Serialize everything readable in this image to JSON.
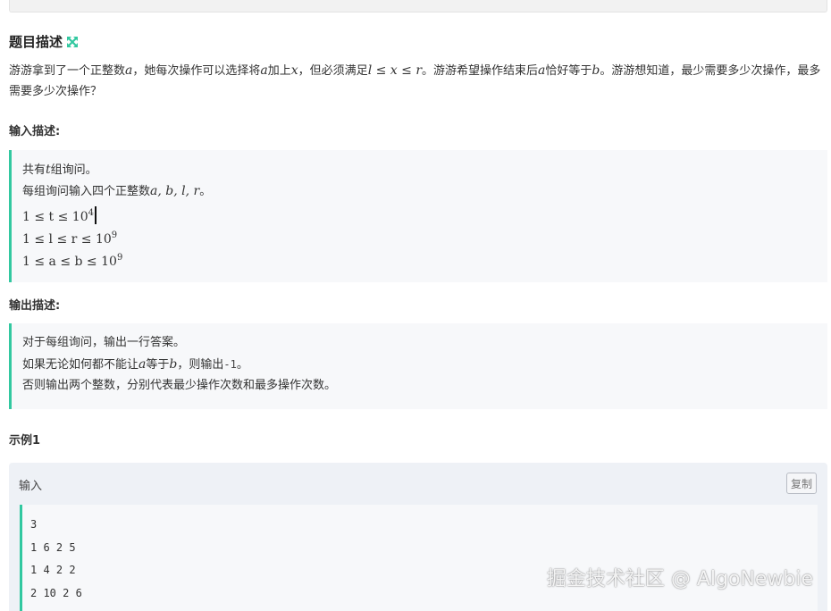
{
  "title": {
    "text": "题目描述",
    "icon": "expand-icon",
    "icon_color": "#32c8a0"
  },
  "description": {
    "p1": "游游拿到了一个正整数",
    "v_a": "a",
    "p2": "，她每次操作可以选择将",
    "v_a2": "a",
    "p3": "加上",
    "v_x": "x",
    "p4": "，但必须满足",
    "constraint": "l ≤ x ≤ r",
    "p5": "。游游希望操作结束后",
    "v_a3": "a",
    "p6": "恰好等于",
    "v_b": "b",
    "p7": "。游游想知道，最少需要多少次操作，最多需要多少次操作？"
  },
  "input_section": {
    "heading": "输入描述:",
    "line1_pre": "共有",
    "line1_var": "t",
    "line1_post": "组询问。",
    "line2_pre": "每组询问输入四个正整数",
    "line2_vars": "a, b, l, r",
    "line2_post": "。",
    "c1_base": "1 ≤ t ≤ 10",
    "c1_exp": "4",
    "c2_base": "1 ≤ l ≤ r ≤ 10",
    "c2_exp": "9",
    "c3_base": "1 ≤ a ≤ b ≤ 10",
    "c3_exp": "9"
  },
  "output_section": {
    "heading": "输出描述:",
    "line1": "对于每组询问，输出一行答案。",
    "line2_pre": "如果无论如何都不能让",
    "line2_a": "a",
    "line2_mid": "等于",
    "line2_b": "b",
    "line2_post1": "，则输出",
    "line2_code": "-1",
    "line2_post2": "。",
    "line3": "否则输出两个整数，分别代表最少操作次数和最多操作次数。"
  },
  "example": {
    "heading": "示例1",
    "input_label": "输入",
    "copy_label": "复制",
    "lines": [
      "3",
      "1 6 2 5",
      "1 4 2 2",
      "2 10 2 6"
    ]
  },
  "watermark": "掘金技术社区 @ AlgoNewbie",
  "colors": {
    "accent": "#32c8a0",
    "quote_bg": "#f7f8fa",
    "example_bg": "#eef1f6"
  }
}
